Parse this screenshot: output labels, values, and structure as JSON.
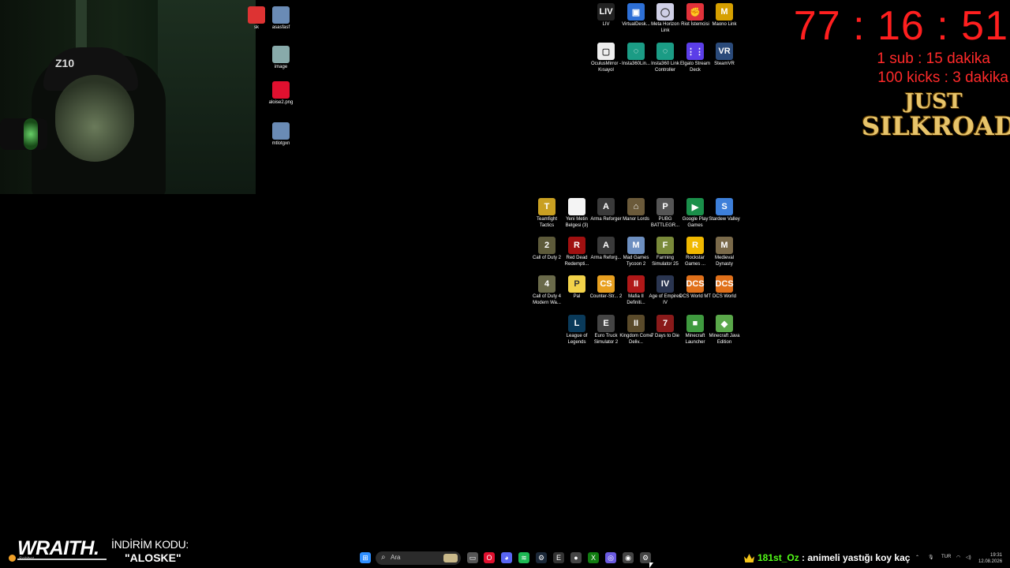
{
  "timer": {
    "value": "77 : 16 : 51",
    "sub_rule": "1 sub : 15 dakika",
    "kick_rule": "100 kicks : 3 dakika"
  },
  "logo": {
    "line1": "JUST",
    "line2": "SILKROAD"
  },
  "webcam": {
    "cap_text": "Z10"
  },
  "desktop_left": [
    {
      "label": "sk",
      "icon": "app-icon",
      "color": "#d33"
    },
    {
      "label": "asasfasf",
      "icon": "image-icon",
      "color": "#6a8bb5"
    },
    {
      "label": "image",
      "icon": "image-icon",
      "color": "#8aa"
    },
    {
      "label": "aloise2.png",
      "icon": "opera-icon",
      "color": "#e0102f"
    },
    {
      "label": "mtlotgxn",
      "icon": "image-icon",
      "color": "#6a8bb5"
    }
  ],
  "desktop_top": [
    {
      "label": "LIV",
      "icon": "liv-icon",
      "color": "#222",
      "glyph": "LIV"
    },
    {
      "label": "VirtualDesk...",
      "icon": "virtual-desktop-icon",
      "color": "#2d6fd6",
      "glyph": "▣"
    },
    {
      "label": "Meta Horizon Link",
      "icon": "meta-quest-icon",
      "color": "#cfcfe6",
      "glyph": "◯"
    },
    {
      "label": "Riot İstemcisi",
      "icon": "riot-icon",
      "color": "#e1323a",
      "glyph": "✊"
    },
    {
      "label": "Maono Link",
      "icon": "maono-icon",
      "color": "#d6a000",
      "glyph": "M"
    },
    {
      "label": "OculusMirror - Kısayol",
      "icon": "oculus-mirror-icon",
      "color": "#eee",
      "glyph": "▢"
    },
    {
      "label": "Insta360Lin...",
      "icon": "insta360-icon",
      "color": "#1b9c85",
      "glyph": "◌"
    },
    {
      "label": "Insta360 Link Controller",
      "icon": "insta360-controller-icon",
      "color": "#1b9c85",
      "glyph": "◌"
    },
    {
      "label": "Elgato Stream Deck",
      "icon": "stream-deck-icon",
      "color": "#5b3ee8",
      "glyph": "⋮⋮"
    },
    {
      "label": "SteamVR",
      "icon": "steamvr-icon",
      "color": "#2a4a7a",
      "glyph": "VR"
    }
  ],
  "desktop_games": [
    {
      "label": "Teamfight Tactics",
      "icon": "tft-icon",
      "color": "#c9a022",
      "glyph": "T"
    },
    {
      "label": "Yeni Metin Belgesi (3)",
      "icon": "text-file-icon",
      "color": "#f4f4f4",
      "glyph": ""
    },
    {
      "label": "Arma Reforger",
      "icon": "arma-icon",
      "color": "#3a3a3a",
      "glyph": "A"
    },
    {
      "label": "Manor Lords",
      "icon": "manor-lords-icon",
      "color": "#6b5a3a",
      "glyph": "⌂"
    },
    {
      "label": "PUBG BATTLEGR...",
      "icon": "pubg-icon",
      "color": "#555",
      "glyph": "P"
    },
    {
      "label": "Google Play Games",
      "icon": "google-play-games-icon",
      "color": "#1a8f4a",
      "glyph": "▶"
    },
    {
      "label": "Stardew Valley",
      "icon": "stardew-icon",
      "color": "#3d7fd9",
      "glyph": "S"
    },
    {
      "label": "Call of Duty 2",
      "icon": "cod2-icon",
      "color": "#5d5a3a",
      "glyph": "2"
    },
    {
      "label": "Red Dead Redempti...",
      "icon": "rdr-icon",
      "color": "#a01010",
      "glyph": "R"
    },
    {
      "label": "Arma Reforg...",
      "icon": "arma-icon",
      "color": "#3a3a3a",
      "glyph": "A"
    },
    {
      "label": "Mad Games Tycoon 2",
      "icon": "mad-games-icon",
      "color": "#6d8fc0",
      "glyph": "M"
    },
    {
      "label": "Farming Simulator 25",
      "icon": "farming-sim-icon",
      "color": "#7a8a3a",
      "glyph": "F"
    },
    {
      "label": "Rockstar Games ...",
      "icon": "rockstar-icon",
      "color": "#f0b800",
      "glyph": "R"
    },
    {
      "label": "Medieval Dynasty",
      "icon": "medieval-dynasty-icon",
      "color": "#7a6a4a",
      "glyph": "M"
    },
    {
      "label": "Call of Duty 4 Modern Wa...",
      "icon": "cod4-icon",
      "color": "#6a6a4a",
      "glyph": "4"
    },
    {
      "label": "Pal",
      "icon": "palworld-icon",
      "color": "#f2d24a",
      "glyph": "P"
    },
    {
      "label": "Counter-Str... 2",
      "icon": "cs2-icon",
      "color": "#e8a020",
      "glyph": "CS"
    },
    {
      "label": "Mafia II Definiti...",
      "icon": "mafia-icon",
      "color": "#b01818",
      "glyph": "II"
    },
    {
      "label": "Age of Empires IV",
      "icon": "aoe-icon",
      "color": "#2a3550",
      "glyph": "IV"
    },
    {
      "label": "DCS World MT",
      "icon": "dcs-icon",
      "color": "#e0701a",
      "glyph": "DCS"
    },
    {
      "label": "DCS World",
      "icon": "dcs-icon",
      "color": "#e0701a",
      "glyph": "DCS"
    },
    {
      "label": "League of Legends",
      "icon": "lol-icon",
      "color": "#0a3a5a",
      "glyph": "L"
    },
    {
      "label": "Euro Truck Simulator 2",
      "icon": "ets2-icon",
      "color": "#444",
      "glyph": "E"
    },
    {
      "label": "Kingdom Come Deliv...",
      "icon": "kcd-icon",
      "color": "#5a4a2a",
      "glyph": "II"
    },
    {
      "label": "7 Days to Die",
      "icon": "7days-icon",
      "color": "#8a1a1a",
      "glyph": "7"
    },
    {
      "label": "Minecraft Launcher",
      "icon": "minecraft-launcher-icon",
      "color": "#3f9a3f",
      "glyph": "■"
    },
    {
      "label": "Minecraft Java Edition",
      "icon": "minecraft-java-icon",
      "color": "#5aa84a",
      "glyph": "◆"
    }
  ],
  "brand": {
    "name": "WRAITH.",
    "promo_label": "İNDİRİM KODU:",
    "promo_code": "\"ALOSKE\""
  },
  "taskbar": {
    "search_placeholder": "Ara",
    "apps": [
      {
        "name": "start-icon",
        "color": "#2f8fff",
        "glyph": "⊞"
      },
      {
        "name": "file-explorer-icon",
        "color": "#555",
        "glyph": "▭"
      },
      {
        "name": "opera-gx-icon",
        "color": "#e0102f",
        "glyph": "O"
      },
      {
        "name": "discord-icon",
        "color": "#5865f2",
        "glyph": "◕"
      },
      {
        "name": "spotify-icon",
        "color": "#1db954",
        "glyph": "≋"
      },
      {
        "name": "steam-icon",
        "color": "#1b2838",
        "glyph": "⚙"
      },
      {
        "name": "epic-games-icon",
        "color": "#333",
        "glyph": "E"
      },
      {
        "name": "obs-icon",
        "color": "#444",
        "glyph": "●"
      },
      {
        "name": "xbox-icon",
        "color": "#107c10",
        "glyph": "X"
      },
      {
        "name": "copilot-icon",
        "color": "#6b5be0",
        "glyph": "◎"
      },
      {
        "name": "chrome-icon",
        "color": "#444",
        "glyph": "◉"
      },
      {
        "name": "settings-icon",
        "color": "#444",
        "glyph": "⚙"
      }
    ],
    "chat_user": "181st_Oz",
    "chat_message": " : animeli yastığı koy kaç",
    "language": "TUR",
    "time": "19:31",
    "date": "12.08.2026"
  },
  "tray": {
    "app_label": "Sohbet"
  }
}
